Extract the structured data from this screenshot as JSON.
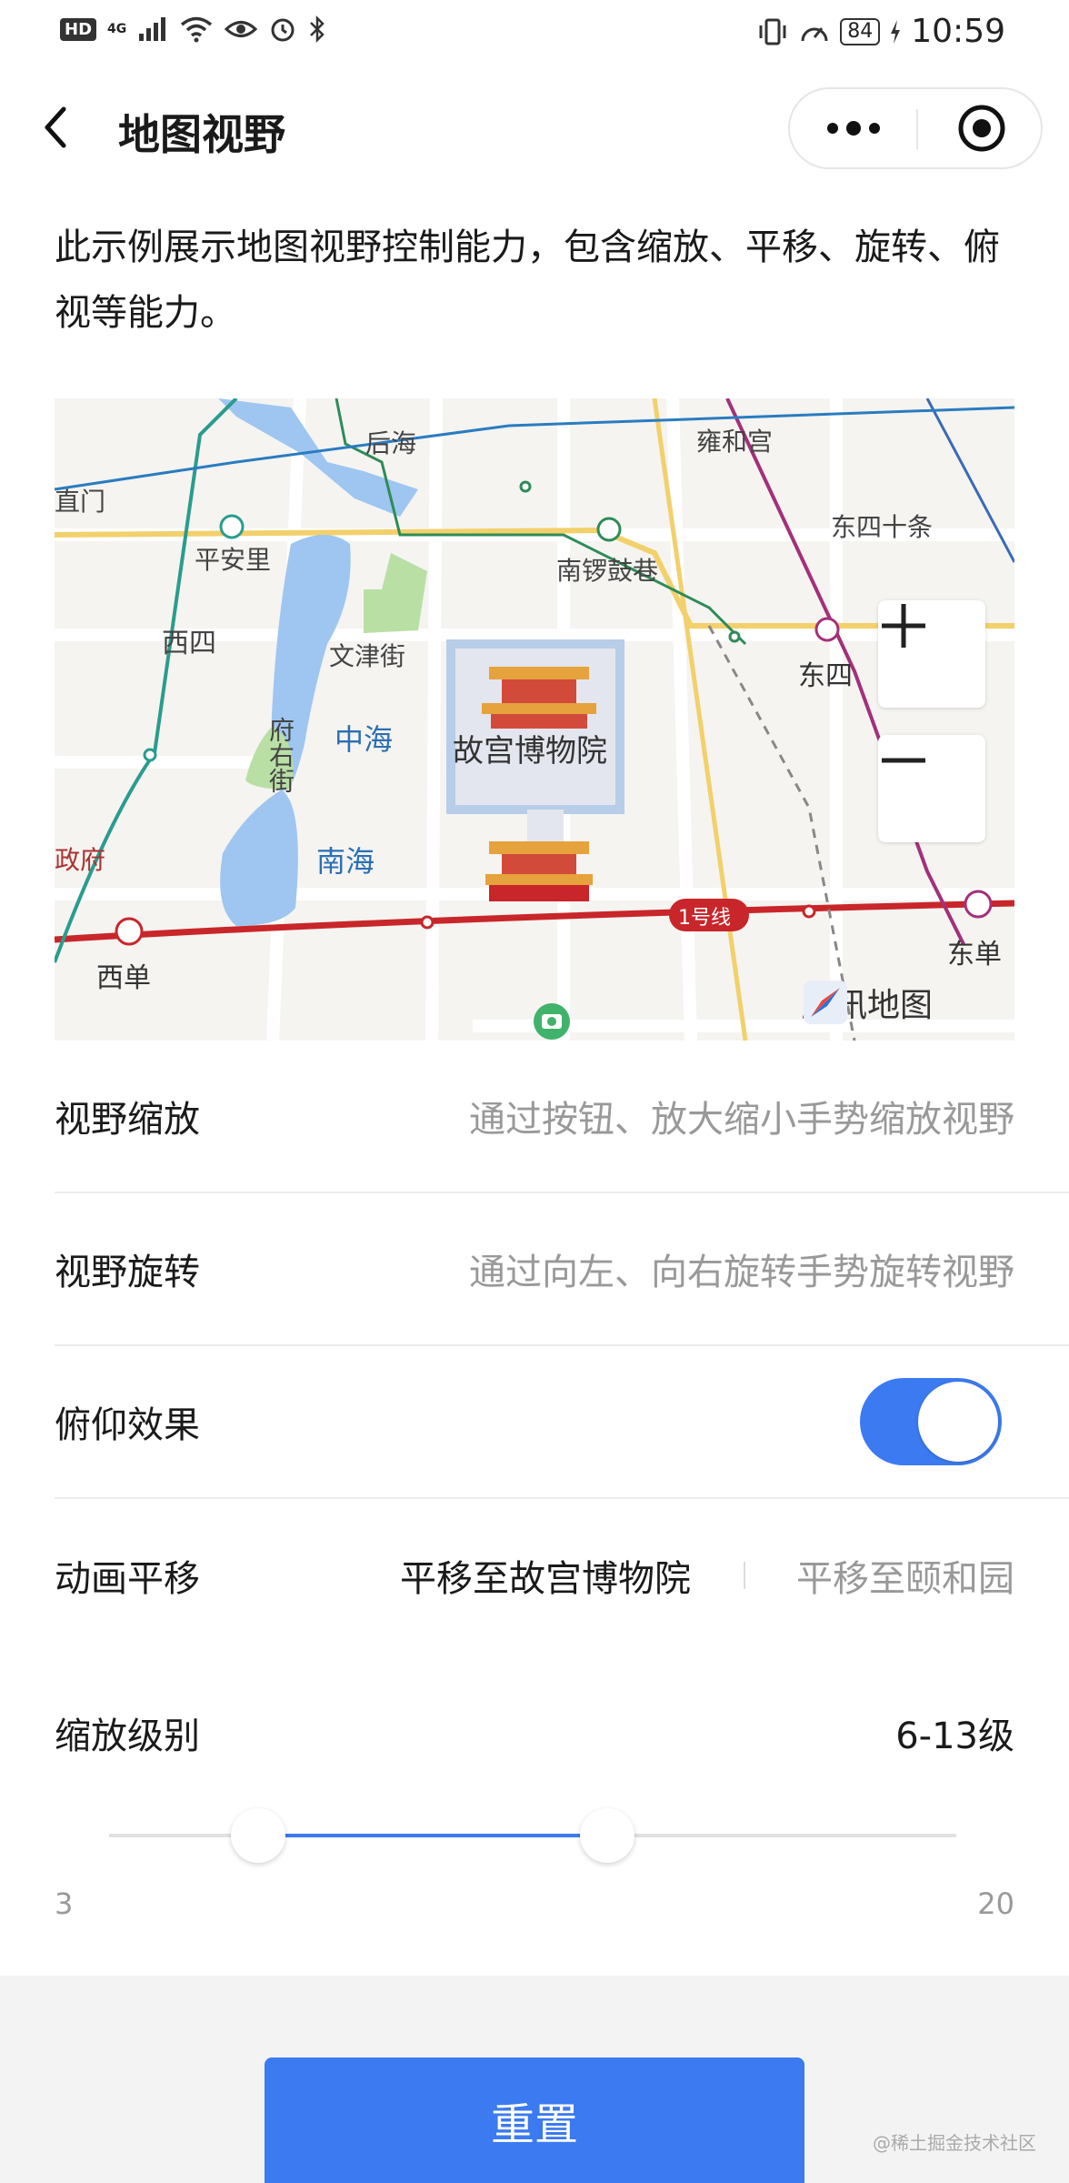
{
  "status_bar": {
    "hd": "HD",
    "network": "4G",
    "battery": "84",
    "time": "10:59"
  },
  "nav": {
    "title": "地图视野"
  },
  "intro": "此示例展示地图视野控制能力，包含缩放、平移、旋转、俯视等能力。",
  "map": {
    "labels": {
      "houhai": "后海",
      "yonghegong": "雍和宫",
      "zhimen": "直门",
      "pinganli": "平安里",
      "nanluoguxiang": "南锣鼓巷",
      "dongsishitiao": "东四十条",
      "xisi": "西四",
      "wenjinjie": "文津街",
      "dongsi": "东四",
      "fuyoujie": "府右街",
      "zhonghai": "中海",
      "gugong": "故宫博物院",
      "nanhai": "南海",
      "zhengfu": "政府",
      "xidan": "西单",
      "dongdan": "东单",
      "line1": "1号线"
    },
    "brand": "腾讯地图",
    "zoom_in": "+",
    "zoom_out": "—"
  },
  "rows": {
    "zoom": {
      "label": "视野缩放",
      "desc": "通过按钮、放大缩小手势缩放视野"
    },
    "rotate": {
      "label": "视野旋转",
      "desc": "通过向左、向右旋转手势旋转视野"
    },
    "pitch": {
      "label": "俯仰效果",
      "enabled": true
    },
    "pan": {
      "label": "动画平移",
      "option1": "平移至故宫博物院",
      "option2": "平移至颐和园"
    }
  },
  "zoom_level": {
    "label": "缩放级别",
    "value": "6-13级",
    "min": "3",
    "max": "20",
    "range_min": 3,
    "range_max": 20,
    "low": 6,
    "high": 13
  },
  "reset_label": "重置",
  "watermark": "@稀土掘金技术社区",
  "colors": {
    "accent": "#3b7af0",
    "metro_line1": "#c8262a"
  }
}
